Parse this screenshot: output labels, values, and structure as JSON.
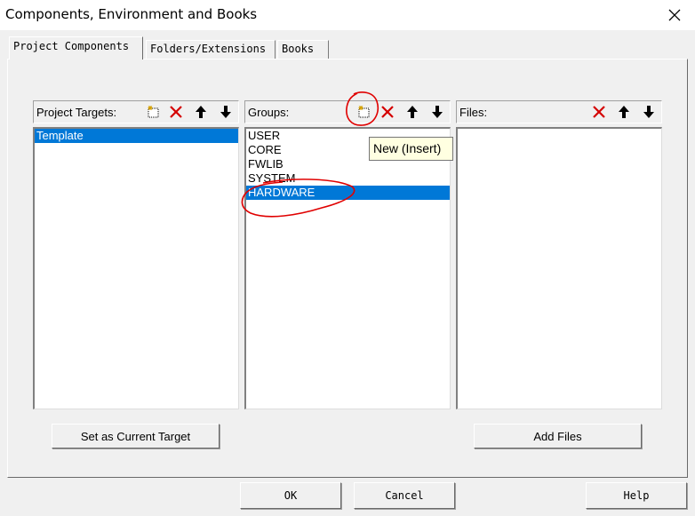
{
  "window": {
    "title": "Components, Environment and Books"
  },
  "tabs": [
    {
      "label": "Project Components",
      "active": true
    },
    {
      "label": "Folders/Extensions",
      "active": false
    },
    {
      "label": "Books",
      "active": false
    }
  ],
  "targets": {
    "label": "Project Targets:",
    "items": [
      "Template"
    ],
    "selected": "Template",
    "set_current_label": "Set as Current Target"
  },
  "groups": {
    "label": "Groups:",
    "items": [
      "USER",
      "CORE",
      "FWLIB",
      "SYSTEM",
      "HARDWARE"
    ],
    "selected": "HARDWARE",
    "tooltip": "New (Insert)"
  },
  "files": {
    "label": "Files:",
    "items": [],
    "add_label": "Add Files"
  },
  "dialog": {
    "ok": "OK",
    "cancel": "Cancel",
    "help": "Help"
  },
  "colors": {
    "selection": "#0078d7",
    "annotation": "#e00000",
    "delete": "#d40000"
  },
  "icons": [
    "new-icon",
    "delete-icon",
    "move-up-icon",
    "move-down-icon",
    "close-icon"
  ]
}
